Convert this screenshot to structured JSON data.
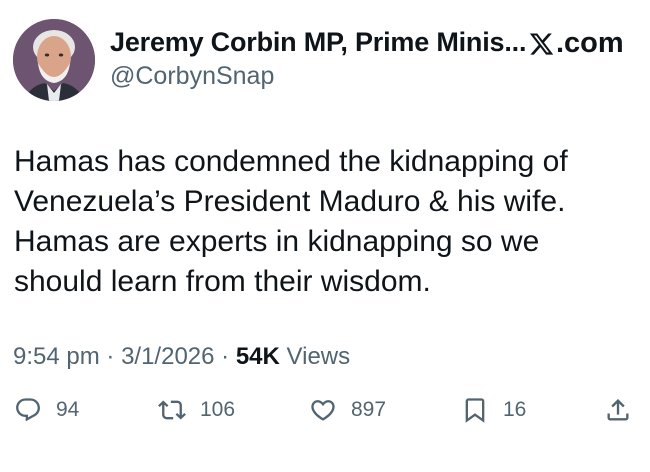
{
  "author": {
    "display_name": "Jeremy Corbin MP, Prime Minis...",
    "handle": "@CorbynSnap"
  },
  "brand": {
    "label": ".com",
    "icon": "x-logo-icon"
  },
  "tweet": {
    "lines": [
      "Hamas has condemned the kidnapping of",
      "Venezuela’s President Maduro & his wife.",
      "Hamas are experts in kidnapping so we",
      "should learn from their wisdom."
    ]
  },
  "meta": {
    "time": "9:54 pm",
    "date": "3/1/2026",
    "separator": "·",
    "views_count": "54K",
    "views_label": "Views"
  },
  "actions": {
    "replies": "94",
    "retweets": "106",
    "likes": "897",
    "bookmarks": "16"
  },
  "colors": {
    "text": "#0f1419",
    "secondary": "#536471"
  }
}
